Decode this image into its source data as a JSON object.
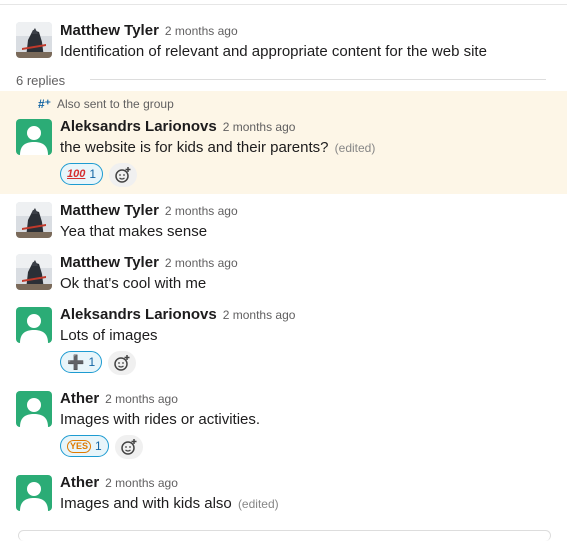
{
  "thread": {
    "replies_label": "6 replies",
    "sent_to_group": "Also sent to the group"
  },
  "messages": [
    {
      "author": "Matthew Tyler",
      "time": "2 months ago",
      "text": "Identification of relevant and appropriate content for the web site",
      "avatar": "photo",
      "edited": ""
    },
    {
      "author": "Aleksandrs Larionovs",
      "time": "2 months ago",
      "text": "the website is for kids and their parents?",
      "avatar": "default",
      "edited": "(edited)",
      "reactions": [
        {
          "emoji": "100",
          "count": "1"
        }
      ]
    },
    {
      "author": "Matthew Tyler",
      "time": "2 months ago",
      "text": "Yea that makes sense",
      "avatar": "photo",
      "edited": ""
    },
    {
      "author": "Matthew Tyler",
      "time": "2 months ago",
      "text": "Ok that's cool with me",
      "avatar": "photo",
      "edited": ""
    },
    {
      "author": "Aleksandrs Larionovs",
      "time": "2 months ago",
      "text": "Lots of images",
      "avatar": "default",
      "edited": "",
      "reactions": [
        {
          "emoji": "heavy-plus",
          "count": "1"
        }
      ]
    },
    {
      "author": "Ather",
      "time": "2 months ago",
      "text": "Images with rides or activities.",
      "avatar": "default",
      "edited": "",
      "reactions": [
        {
          "emoji": "yes",
          "count": "1"
        }
      ]
    },
    {
      "author": "Ather",
      "time": "2 months ago",
      "text": "Images and with kids also",
      "avatar": "default",
      "edited": "(edited)"
    }
  ],
  "emoji_glyphs": {
    "hundred": "100",
    "plus": "➕",
    "yes": "YES"
  },
  "colors": {
    "highlight_bg": "#fdf6e7",
    "default_avatar": "#2bac76",
    "reaction_border": "#1d9bd1",
    "link": "#1264a3"
  }
}
